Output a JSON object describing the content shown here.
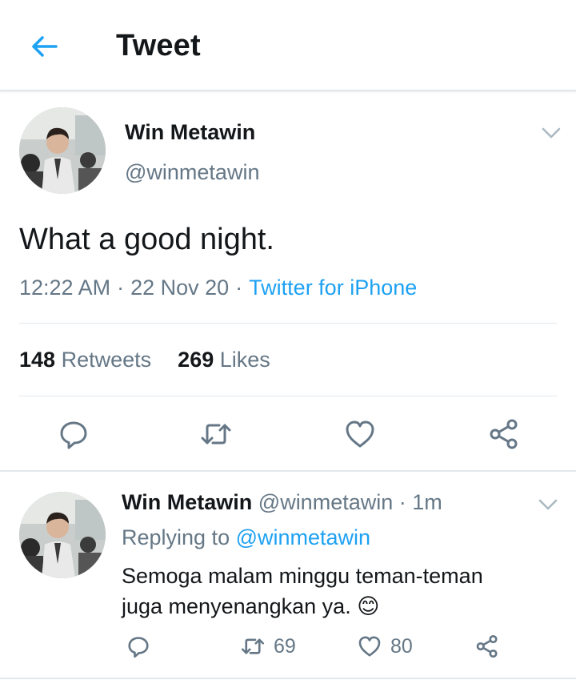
{
  "header": {
    "title": "Tweet"
  },
  "tweet": {
    "author_name": "Win Metawin",
    "author_handle": "@winmetawin",
    "text": "What a good night.",
    "time": "12:22 AM",
    "date": "22 Nov 20",
    "separator": "·",
    "source": "Twitter for iPhone",
    "retweets_count": "148",
    "retweets_label": "Retweets",
    "likes_count": "269",
    "likes_label": "Likes"
  },
  "reply": {
    "author_name": "Win Metawin",
    "author_handle": "@winmetawin",
    "time_ago": "· 1m",
    "replying_label": "Replying to",
    "replying_to": "@winmetawin",
    "text_line1": "Semoga malam minggu teman-teman",
    "text_line2": "juga menyenangkan ya.",
    "emoji": "😊",
    "retweets_count": "69",
    "likes_count": "80"
  },
  "icons": {
    "back": "arrow-left-icon",
    "caret": "chevron-down-icon",
    "reply": "comment-icon",
    "retweet": "retweet-icon",
    "like": "heart-icon",
    "share": "share-icon"
  },
  "colors": {
    "accent": "#1da1f2",
    "secondary_text": "#657786",
    "primary_text": "#14171a",
    "divider": "#e1e8ed"
  }
}
